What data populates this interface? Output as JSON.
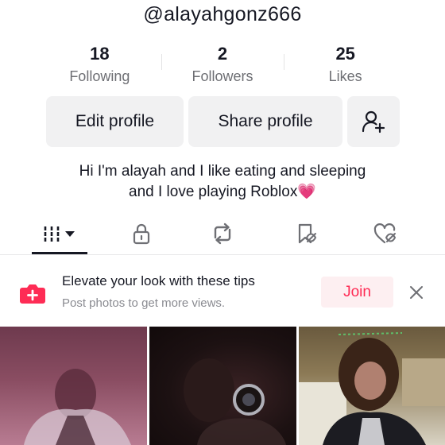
{
  "profile": {
    "username": "@alayahgonz666",
    "stats": [
      {
        "value": "18",
        "label": "Following"
      },
      {
        "value": "2",
        "label": "Followers"
      },
      {
        "value": "25",
        "label": "Likes"
      }
    ],
    "buttons": {
      "edit": "Edit profile",
      "share": "Share profile"
    },
    "bio": {
      "line1": "Hi I'm alayah and I like eating and sleeping",
      "line2": "and I love playing Roblox💗"
    }
  },
  "tabs": {
    "icons": [
      "videos-grid-icon",
      "lock-icon",
      "repost-icon",
      "favorites-icon",
      "liked-icon"
    ],
    "active": "videos-grid-icon"
  },
  "promo": {
    "title": "Elevate your look with these tips",
    "subtitle": "Post photos to get more views.",
    "join_label": "Join",
    "icon": "camera-plus-icon"
  },
  "colors": {
    "accent": "#fe2c55",
    "text": "#161823",
    "muted": "#6e6f74",
    "button_bg": "#f1f1f2"
  }
}
